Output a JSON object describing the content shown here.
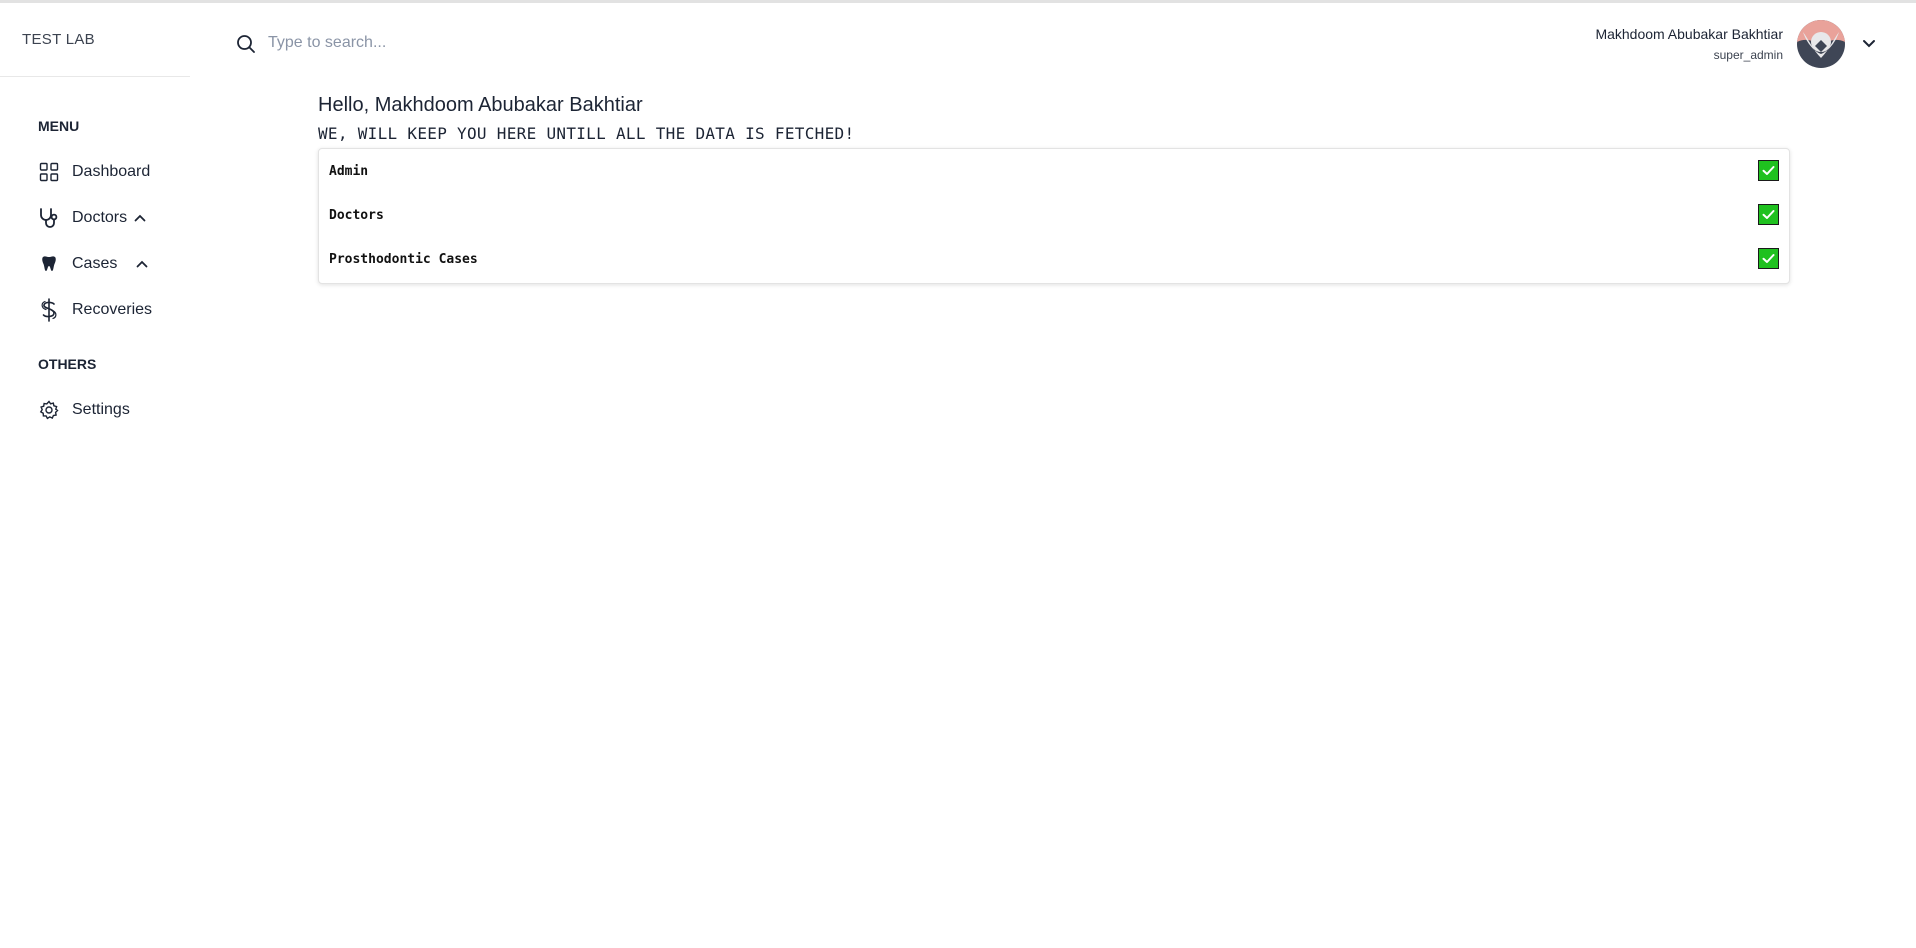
{
  "app": {
    "brand": "TEST LAB"
  },
  "sidebar": {
    "menu_label": "MENU",
    "others_label": "OTHERS",
    "items": [
      {
        "label": "Dashboard",
        "icon": "grid-icon"
      },
      {
        "label": "Doctors",
        "icon": "stethoscope-icon",
        "expanded": true
      },
      {
        "label": "Cases",
        "icon": "tooth-icon",
        "expanded": true
      },
      {
        "label": "Recoveries",
        "icon": "dollar-icon"
      }
    ],
    "others": [
      {
        "label": "Settings",
        "icon": "gear-icon"
      }
    ]
  },
  "header": {
    "search_placeholder": "Type to search...",
    "user_name": "Makhdoom Abubakar Bakhtiar",
    "user_role": "super_admin"
  },
  "main": {
    "greeting": "Hello, Makhdoom Abubakar Bakhtiar",
    "subtitle": "WE, WILL KEEP YOU HERE UNTILL ALL THE DATA IS FETCHED!",
    "status_items": [
      {
        "label": "Admin",
        "checked": true
      },
      {
        "label": "Doctors",
        "checked": true
      },
      {
        "label": "Prosthodontic Cases",
        "checked": true
      }
    ]
  },
  "colors": {
    "text": "#1c2434",
    "check_green": "#1fc11f",
    "placeholder": "#8a94a6"
  }
}
